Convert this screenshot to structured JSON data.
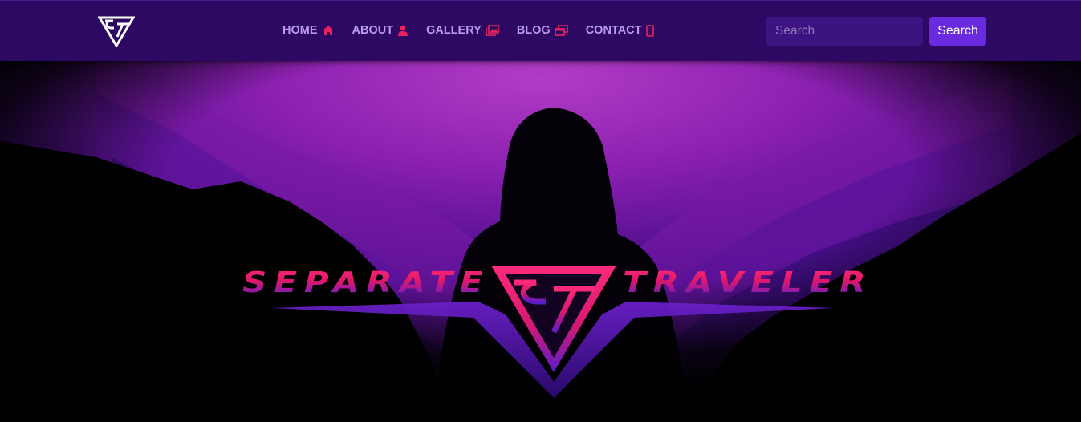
{
  "navbar": {
    "logo_icon": "st-logo-icon",
    "items": [
      {
        "label": "HOME",
        "icon": "home-icon"
      },
      {
        "label": "ABOUT",
        "icon": "user-icon"
      },
      {
        "label": "GALLERY",
        "icon": "images-icon"
      },
      {
        "label": "BLOG",
        "icon": "window-restore-icon"
      },
      {
        "label": "CONTACT",
        "icon": "mobile-icon"
      }
    ],
    "search": {
      "placeholder": "Search",
      "value": "",
      "button_label": "Search"
    }
  },
  "hero": {
    "title_left": "SEPARATE",
    "title_right": "TRAVELER",
    "logo": "st-emblem"
  },
  "colors": {
    "navbar_bg": "#2e0963",
    "nav_text": "#b89cf0",
    "nav_icon": "#e8235e",
    "search_button": "#6a2ae0",
    "accent_pink": "#ff2a7a",
    "hero_purple": "#8e2cb8"
  }
}
